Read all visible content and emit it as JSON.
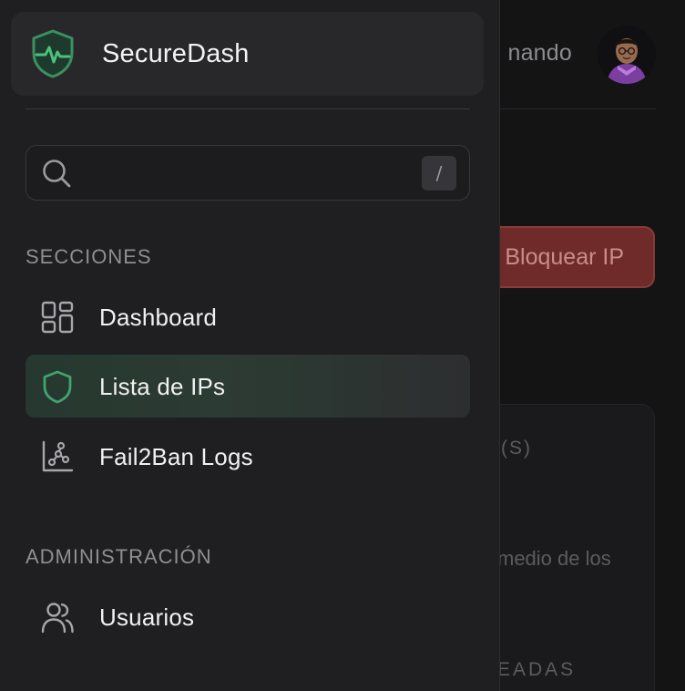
{
  "background": {
    "username": "nando",
    "block_ip_button": "Bloquear IP",
    "card_label": "(S)",
    "card_description": "medio de los",
    "card_footer": "EADAS"
  },
  "sidebar": {
    "brand": {
      "name": "SecureDash",
      "logo_icon": "shield-heartbeat-icon"
    },
    "search": {
      "value": "",
      "placeholder": "",
      "shortcut": "/"
    },
    "sections": [
      {
        "title": "SECCIONES",
        "items": [
          {
            "label": "Dashboard",
            "icon": "dashboard-grid-icon",
            "active": false
          },
          {
            "label": "Lista de IPs",
            "icon": "shield-icon",
            "active": true
          },
          {
            "label": "Fail2Ban Logs",
            "icon": "chart-logs-icon",
            "active": false
          }
        ]
      },
      {
        "title": "ADMINISTRACIÓN",
        "items": [
          {
            "label": "Usuarios",
            "icon": "users-icon",
            "active": false
          }
        ]
      }
    ]
  },
  "colors": {
    "accent_green": "#3fa46f",
    "danger_red": "#6e2b2a",
    "sidebar_bg": "#1f1f21",
    "active_item_bg": "#26382f"
  }
}
